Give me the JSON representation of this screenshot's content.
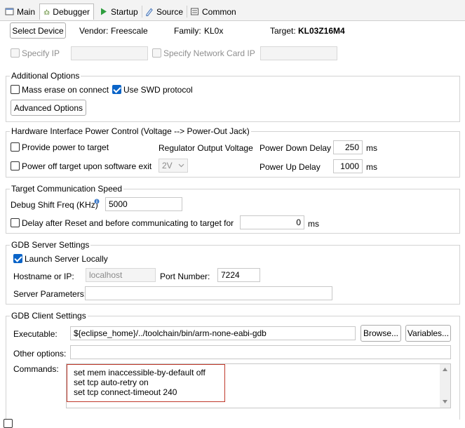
{
  "tabs": [
    {
      "label": "Main",
      "icon": "main-tab-icon"
    },
    {
      "label": "Debugger",
      "icon": "debugger-bug-icon",
      "active": true
    },
    {
      "label": "Startup",
      "icon": "play-icon"
    },
    {
      "label": "Source",
      "icon": "source-icon"
    },
    {
      "label": "Common",
      "icon": "common-icon"
    }
  ],
  "device": {
    "select_label": "Select Device",
    "vendor_label": "Vendor:",
    "vendor_value": "Freescale",
    "family_label": "Family:",
    "family_value": "KL0x",
    "target_label": "Target:",
    "target_value": "KL03Z16M4",
    "specify_ip_label": "Specify IP",
    "specify_ip_value": "",
    "specify_nic_label": "Specify Network Card IP",
    "specify_nic_value": ""
  },
  "additional": {
    "title": "Additional Options",
    "mass_erase_label": "Mass erase on connect",
    "mass_erase_checked": false,
    "swd_label": "Use SWD protocol",
    "swd_checked": true,
    "advanced_label": "Advanced Options"
  },
  "power": {
    "title": "Hardware Interface Power Control (Voltage --> Power-Out Jack)",
    "provide_label": "Provide power to target",
    "regulator_label": "Regulator Output Voltage",
    "down_delay_label": "Power Down Delay",
    "down_delay_value": "250",
    "down_delay_unit": "ms",
    "power_off_label": "Power off target upon software exit",
    "voltage_value": "2V",
    "up_delay_label": "Power Up Delay",
    "up_delay_value": "1000",
    "up_delay_unit": "ms"
  },
  "comm": {
    "title": "Target Communication Speed",
    "freq_label": "Debug Shift Freq (KHz)",
    "freq_value": "5000",
    "delay_label": "Delay after Reset and before communicating to target for",
    "delay_value": "0",
    "delay_unit": "ms"
  },
  "server": {
    "title": "GDB Server Settings",
    "launch_label": "Launch Server Locally",
    "launch_checked": true,
    "host_label": "Hostname or IP:",
    "host_value": "localhost",
    "port_label": "Port Number:",
    "port_value": "7224",
    "params_label": "Server Parameters:",
    "params_value": ""
  },
  "client": {
    "title": "GDB Client Settings",
    "exe_label": "Executable:",
    "exe_value": "${eclipse_home}/../toolchain/bin/arm-none-eabi-gdb",
    "browse_label": "Browse...",
    "variables_label": "Variables...",
    "other_label": "Other options:",
    "other_value": "",
    "commands_label": "Commands:",
    "commands": [
      "set mem inaccessible-by-default off",
      "set tcp auto-retry on",
      "set tcp connect-timeout 240"
    ]
  },
  "colors": {
    "accent": "#0a64c8",
    "highlight_box": "#c0392b"
  }
}
